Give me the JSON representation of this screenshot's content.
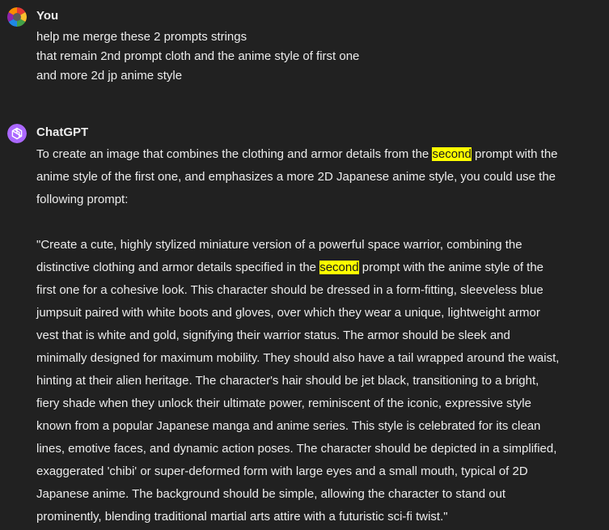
{
  "conversation": {
    "user": {
      "name": "You",
      "lines": [
        "help me merge these 2 prompts strings",
        "that remain 2nd prompt cloth and the anime style of first one",
        "and more 2d jp anime style"
      ]
    },
    "assistant": {
      "name": "ChatGPT",
      "intro_lines": [
        "To create an image that combines the clothing and armor details from the ",
        "second",
        " prompt with the",
        "anime style of the first one, and emphasizes a more 2D Japanese anime style, you could use the",
        "following prompt:"
      ],
      "quote_lines": [
        "\"Create a cute, highly stylized miniature version of a powerful space warrior, combining the",
        "distinctive clothing and armor details specified in the ",
        "second",
        " prompt with the anime style of the",
        "first one for a cohesive look. This character should be dressed in a form-fitting, sleeveless blue",
        "jumpsuit paired with white boots and gloves, over which they wear a unique, lightweight armor",
        "vest that is white and gold, signifying their warrior status. The armor should be sleek and",
        "minimally designed for maximum mobility. They should also have a tail wrapped around the waist,",
        "hinting at their alien heritage. The character's hair should be jet black, transitioning to a bright,",
        "fiery shade when they unlock their ultimate power, reminiscent of the iconic, expressive style",
        "known from a popular Japanese manga and anime series. This style is celebrated for its clean",
        "lines, emotive faces, and dynamic action poses. The character should be depicted in a simplified,",
        "exaggerated 'chibi' or super-deformed form with large eyes and a small mouth, typical of 2D",
        "Japanese anime. The background should be simple, allowing the character to stand out",
        "prominently, blending traditional martial arts attire with a futuristic sci-fi twist.\""
      ]
    }
  },
  "colors": {
    "background": "#212121",
    "text": "#ececec",
    "highlight": "#ffff00",
    "assistant_avatar": "#ab68ff"
  },
  "icons": {
    "user_avatar": "user-avatar-icon",
    "assistant_avatar": "openai-logo-icon"
  }
}
